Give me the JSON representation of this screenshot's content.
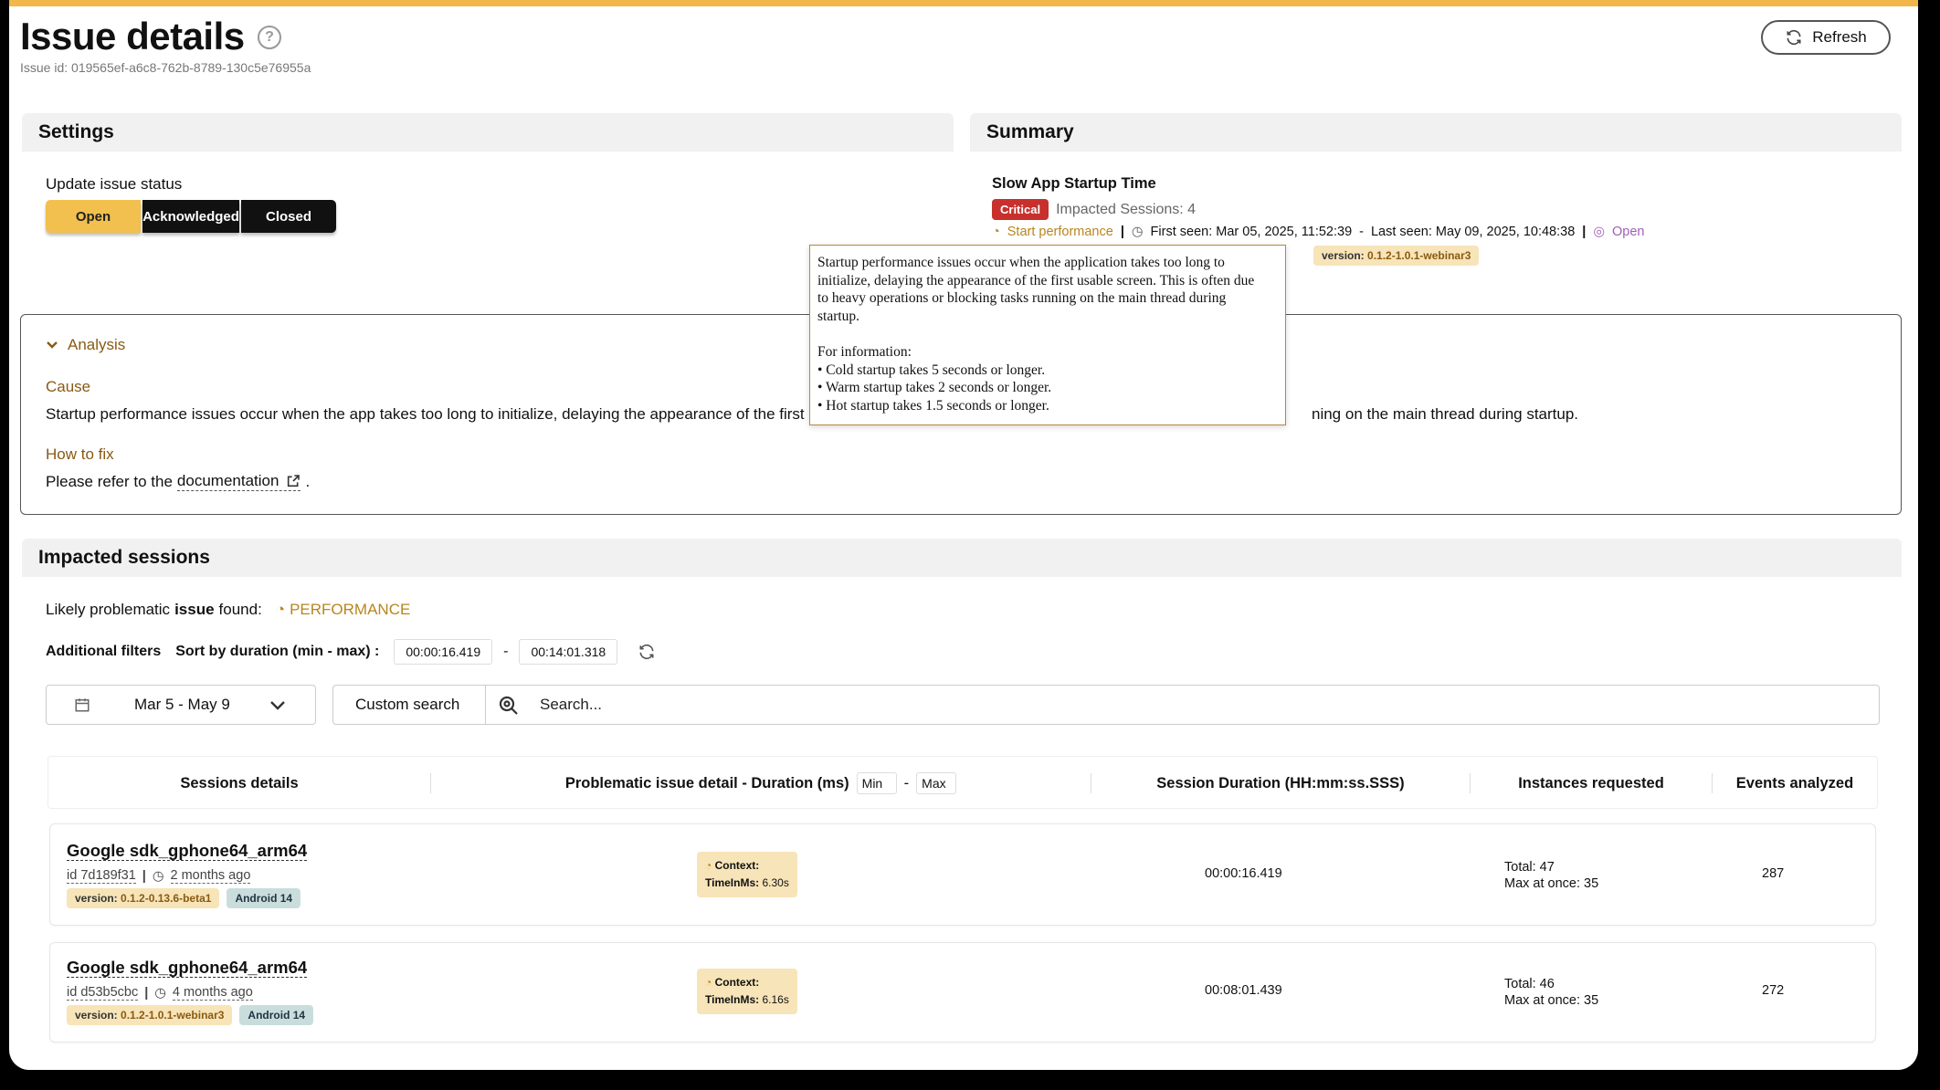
{
  "header": {
    "title": "Issue details",
    "help_glyph": "?",
    "issue_id": "Issue id: 019565ef-a6c8-762b-8789-130c5e76955a",
    "refresh_label": "Refresh"
  },
  "settings": {
    "title": "Settings",
    "status_label": "Update issue status",
    "status_options": [
      "Open",
      "Acknowledged",
      "Closed"
    ],
    "selected_status": "Open"
  },
  "summary": {
    "title": "Summary",
    "issue_name": "Slow App Startup Time",
    "severity": "Critical",
    "impacted": "Impacted Sessions: 4",
    "category": "Start performance",
    "first_seen": "First seen: Mar 05, 2025, 11:52:39",
    "dash": "-",
    "last_seen": "Last seen: May 09, 2025, 10:48:38",
    "status": "Open",
    "version_label": "version:",
    "version_value": "0.1.2-1.0.1-webinar3"
  },
  "tooltip": {
    "lines": [
      "Startup performance issues occur when the application takes too long to",
      "initialize, delaying the appearance of the first usable screen. This is often due",
      "to heavy operations or blocking tasks running on the main thread during",
      "startup.",
      "",
      "For information:",
      "• Cold startup takes 5 seconds or longer.",
      "• Warm startup takes 2 seconds or longer.",
      "• Hot startup takes 1.5 seconds or longer."
    ]
  },
  "analysis": {
    "toggle_label": "Analysis",
    "cause_heading": "Cause",
    "cause_text_left": "Startup performance issues occur when the app takes too long to initialize, delaying the appearance of the first u",
    "cause_text_right": "ning on the main thread during startup.",
    "fix_heading": "How to fix",
    "fix_prefix": "Please refer to the",
    "fix_link": "documentation",
    "fix_suffix": "."
  },
  "impacted": {
    "title": "Impacted sessions",
    "likely_prefix": "Likely problematic",
    "likely_bold": "issue",
    "likely_suffix": "found:",
    "likely_tag": "PERFORMANCE",
    "filters_label": "Additional filters",
    "sort_label": "Sort by duration (min - max) :",
    "min_duration": "00:00:16.419",
    "range_dash": "-",
    "max_duration": "00:14:01.318",
    "date_range": "Mar 5 - May 9",
    "custom_search": "Custom search",
    "search_placeholder": "Search...",
    "columns": {
      "sessions": "Sessions details",
      "problem": "Problematic issue detail - Duration (ms)",
      "min_placeholder": "Min",
      "minmax_dash": "-",
      "max_placeholder": "Max",
      "duration": "Session Duration (HH:mm:ss.SSS)",
      "instances": "Instances requested",
      "events": "Events analyzed"
    },
    "rows": [
      {
        "device": "Google sdk_gphone64_arm64",
        "id": "id 7d189f31",
        "ago": "2 months ago",
        "version_label": "version:",
        "version": "0.1.2-0.13.6-beta1",
        "os": "Android 14",
        "ctx_label": "Context:",
        "ctx_key": "TimeInMs:",
        "ctx_val": "6.30s",
        "duration": "00:00:16.419",
        "total": "Total: 47",
        "max_once": "Max at once: 35",
        "events": "287"
      },
      {
        "device": "Google sdk_gphone64_arm64",
        "id": "id d53b5cbc",
        "ago": "4 months ago",
        "version_label": "version:",
        "version": "0.1.2-1.0.1-webinar3",
        "os": "Android 14",
        "ctx_label": "Context:",
        "ctx_key": "TimeInMs:",
        "ctx_val": "6.16s",
        "duration": "00:08:01.439",
        "total": "Total: 46",
        "max_once": "Max at once: 35",
        "events": "272"
      }
    ]
  },
  "colors": {
    "accent": "#f2c04e",
    "critical": "#c7302c",
    "brown": "#8a5a12",
    "open_status": "#a05fb5"
  }
}
